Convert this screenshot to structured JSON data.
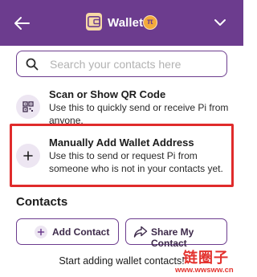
{
  "header": {
    "title": "Wallet",
    "pi_symbol": "π",
    "background_color": "#6c3c8e",
    "back_icon": "arrow-left-icon",
    "dropdown_icon": "chevron-down-icon"
  },
  "search": {
    "placeholder": "Search your contacts here",
    "icon": "search-icon"
  },
  "options": [
    {
      "title": "Scan or Show QR Code",
      "description": "Use this to quickly send or receive Pi from anyone.",
      "icon": "qr-code-icon"
    },
    {
      "title": "Manually Add Wallet Address",
      "description": "Use this to send or request Pi from someone who is not in your contacts yet.",
      "icon": "plus-icon"
    }
  ],
  "contacts": {
    "heading": "Contacts",
    "add_button": "Add Contact",
    "share_button": "Share My Contact",
    "empty_text": "Start adding wallet contacts!"
  },
  "watermark": {
    "text": "链圈子",
    "url": "www.wwsww.cn",
    "color": "#e3322e"
  },
  "highlight_color": "#e02b2b"
}
